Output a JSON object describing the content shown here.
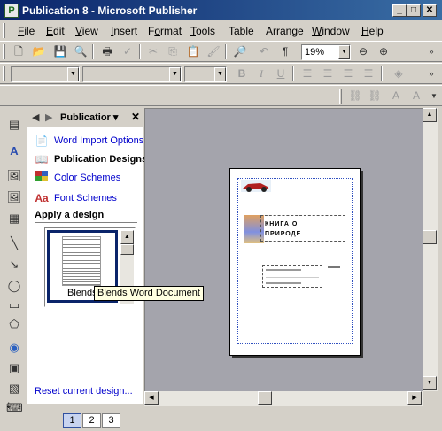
{
  "window": {
    "title": "Publication 8 - Microsoft Publisher",
    "minimize": "_",
    "maximize": "□",
    "close": "✕"
  },
  "menu": [
    {
      "ul": "F",
      "rest": "ile"
    },
    {
      "ul": "E",
      "rest": "dit"
    },
    {
      "ul": "V",
      "rest": "iew"
    },
    {
      "ul": "I",
      "rest": "nsert"
    },
    {
      "ul": "",
      "pre": "F",
      "rest": "o",
      "post": "rmat",
      "label": "Format"
    },
    {
      "ul": "T",
      "rest": "ools"
    },
    {
      "ul": "",
      "label": "Table"
    },
    {
      "ul": "",
      "label": "Arrange"
    },
    {
      "ul": "W",
      "rest": "indow"
    },
    {
      "ul": "H",
      "rest": "elp"
    }
  ],
  "standard_toolbar": {
    "zoom": "19%"
  },
  "taskpane": {
    "title": "Publicatior ▾",
    "links": {
      "word_import": "Word Import Options",
      "publication_designs": "Publication Designs",
      "color_schemes": "Color Schemes",
      "font_schemes": "Font Schemes",
      "apply_design": "Apply a design",
      "thumbnail_caption": "Blends",
      "reset": "Reset current design..."
    }
  },
  "tooltip": "Blends Word Document",
  "page_preview": {
    "title_line1": "КНИГА О",
    "title_line2": "ПРИРОДЕ"
  },
  "page_navigator": [
    "1",
    "2",
    "3"
  ],
  "colors": {
    "titlebar_start": "#0a246a",
    "titlebar_end": "#3a6ea5",
    "link": "#0000cc",
    "workspace": "#a4a4ac",
    "tooltip_bg": "#ffffe1"
  }
}
